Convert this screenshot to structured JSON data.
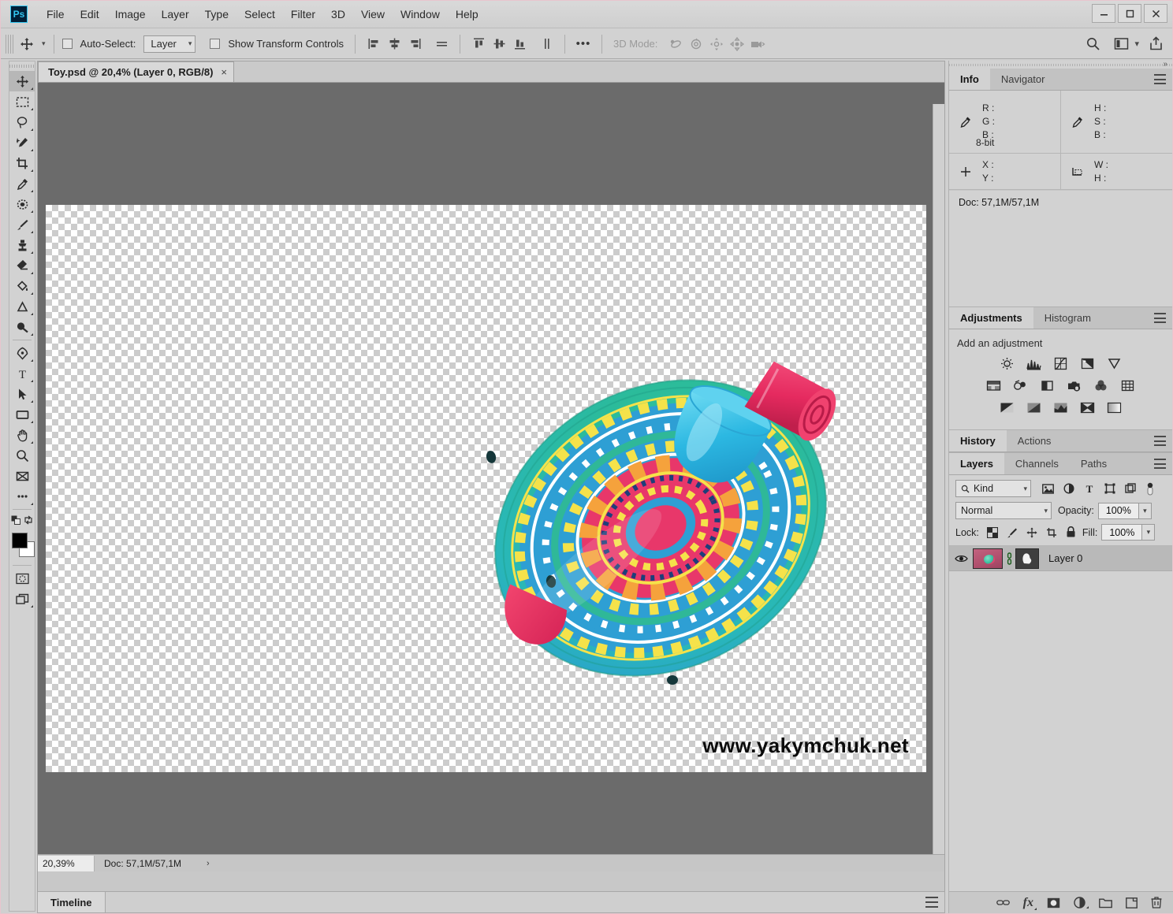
{
  "app": {
    "logo": "ps-logo",
    "menus": [
      "File",
      "Edit",
      "Image",
      "Layer",
      "Type",
      "Select",
      "Filter",
      "3D",
      "View",
      "Window",
      "Help"
    ],
    "window_controls": {
      "minimize": "–",
      "maximize": "❐",
      "close": "✕"
    }
  },
  "options_bar": {
    "tool_icon": "move-tool-icon",
    "auto_select_label": "Auto-Select:",
    "auto_select_checked": false,
    "auto_select_value": "Layer",
    "show_transform_label": "Show Transform Controls",
    "show_transform_checked": false,
    "align_icons": [
      "align-left-edges-icon",
      "align-horizontal-centers-icon",
      "align-right-edges-icon",
      "distribute-horizontally-icon"
    ],
    "distribute_icons": [
      "align-top-edges-icon",
      "align-vertical-centers-icon",
      "align-bottom-edges-icon",
      "distribute-vertically-icon"
    ],
    "more_label": "•••",
    "mode3d_label": "3D Mode:",
    "mode3d_icons": [
      "orbit-3d-icon",
      "roll-3d-icon",
      "pan-3d-icon",
      "slide-3d-icon",
      "zoom-3d-camera-icon"
    ],
    "right_icons": [
      "search-icon",
      "workspace-icon",
      "chevron-down-icon",
      "share-icon"
    ]
  },
  "toolbar": {
    "tools": [
      {
        "name": "move-tool",
        "active": true
      },
      {
        "name": "rectangular-marquee-tool",
        "active": false
      },
      {
        "name": "lasso-tool",
        "active": false
      },
      {
        "name": "quick-selection-tool",
        "active": false
      },
      {
        "name": "crop-tool",
        "active": false
      },
      {
        "name": "eyedropper-tool",
        "active": false
      },
      {
        "name": "spot-healing-brush-tool",
        "active": false
      },
      {
        "name": "brush-tool",
        "active": false
      },
      {
        "name": "clone-stamp-tool",
        "active": false
      },
      {
        "name": "eraser-tool",
        "active": false
      },
      {
        "name": "paint-bucket-tool",
        "active": false
      },
      {
        "name": "dodge-tool",
        "active": false
      },
      {
        "name": "blur-tool",
        "active": false
      },
      {
        "name": "pen-tool",
        "active": false
      },
      {
        "name": "horizontal-type-tool",
        "active": false
      },
      {
        "name": "path-selection-tool",
        "active": false
      },
      {
        "name": "rectangle-tool",
        "active": false
      },
      {
        "name": "hand-tool",
        "active": false
      },
      {
        "name": "zoom-tool",
        "active": false
      },
      {
        "name": "frame-tool",
        "active": false
      },
      {
        "name": "edit-toolbar-tool",
        "active": false
      }
    ],
    "foreground_color": "#000000",
    "background_color": "#ffffff",
    "quick_mask_icon": "quick-mask-icon",
    "screen_mode_icon": "screen-mode-icon"
  },
  "document": {
    "tab_title": "Toy.psd @ 20,4% (Layer 0, RGB/8)",
    "tab_close": "×",
    "watermark": "www.yakymchuk.net",
    "status": {
      "zoom": "20,39%",
      "doc_size": "Doc: 57,1M/57,1M",
      "arrow": "›"
    }
  },
  "timeline": {
    "tab_label": "Timeline"
  },
  "info_panel": {
    "tabs": [
      {
        "label": "Info",
        "active": true
      },
      {
        "label": "Navigator",
        "active": false
      }
    ],
    "rgb": {
      "icon": "eyedropper-icon",
      "rows": [
        "R :",
        "G :",
        "B :"
      ],
      "depth": "8-bit"
    },
    "hsb": {
      "icon": "eyedropper-icon",
      "rows": [
        "H :",
        "S :",
        "B :"
      ]
    },
    "position": {
      "icon": "crosshair-icon",
      "rows": [
        "X :",
        "Y :"
      ]
    },
    "size": {
      "icon": "marquee-size-icon",
      "rows": [
        "W :",
        "H :"
      ]
    },
    "doc_size": "Doc: 57,1M/57,1M"
  },
  "adjustments_panel": {
    "tabs": [
      {
        "label": "Adjustments",
        "active": true
      },
      {
        "label": "Histogram",
        "active": false
      }
    ],
    "heading": "Add an adjustment",
    "row1": [
      "brightness-contrast-icon",
      "levels-icon",
      "curves-icon",
      "exposure-icon",
      "vibrance-icon"
    ],
    "row2": [
      "hue-saturation-icon",
      "color-balance-icon",
      "black-white-icon",
      "photo-filter-icon",
      "channel-mixer-icon",
      "color-lookup-icon"
    ],
    "row3": [
      "invert-icon",
      "posterize-icon",
      "threshold-icon",
      "selective-color-icon",
      "gradient-map-icon"
    ]
  },
  "history_panel": {
    "tabs": [
      {
        "label": "History",
        "active": true
      },
      {
        "label": "Actions",
        "active": false
      }
    ]
  },
  "layers_panel": {
    "tabs": [
      {
        "label": "Layers",
        "active": true
      },
      {
        "label": "Channels",
        "active": false
      },
      {
        "label": "Paths",
        "active": false
      }
    ],
    "filter_kind": "Kind",
    "filter_icons": [
      "filter-pixel-icon",
      "filter-adjustment-icon",
      "filter-type-icon",
      "filter-shape-icon",
      "filter-smart-object-icon",
      "filter-toggle-icon"
    ],
    "blend_mode": "Normal",
    "opacity_label": "Opacity:",
    "opacity_value": "100%",
    "lock_label": "Lock:",
    "lock_icons": [
      "lock-transparent-pixels-icon",
      "lock-image-pixels-icon",
      "lock-position-icon",
      "lock-artboard-icon",
      "lock-all-icon"
    ],
    "fill_label": "Fill:",
    "fill_value": "100%",
    "layers": [
      {
        "name": "Layer 0",
        "visible": true,
        "selected": true,
        "has_mask": true,
        "link_icon": "link-icon",
        "eye_icon": "eye-icon"
      }
    ],
    "footer_icons": [
      "link-layers-icon",
      "layer-style-icon",
      "add-layer-mask-icon",
      "new-fill-adjustment-icon",
      "new-group-icon",
      "new-layer-icon",
      "delete-layer-icon"
    ],
    "footer_fx_label": "fx"
  },
  "colors": {
    "ui_background": "#d2d2d2",
    "canvas_background": "#6b6b6b",
    "accent_blue": "#31c5f0",
    "panel_dark": "#001e36",
    "selected_row": "#b9b9b9",
    "toy_green": "#2fb898",
    "toy_pink": "#e8376a",
    "toy_blue": "#2e9fd4",
    "toy_yellow": "#f5e24a",
    "toy_cyan": "#2bbce0",
    "toy_orange": "#f5a23c"
  }
}
